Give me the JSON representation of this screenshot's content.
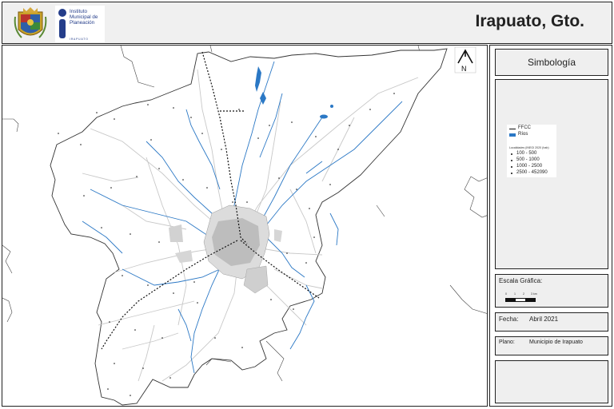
{
  "header": {
    "title": "Irapuato, Gto.",
    "institute_lines": [
      "Instituto",
      "Municipal de",
      "Planeación"
    ],
    "institute_sub": "IRAPUATO"
  },
  "map": {
    "north_label": "N",
    "colors": {
      "rivers": "#2b78c5",
      "railway": "#111111",
      "roads": "#c8c8c8",
      "municipality_fill": "#ffffff",
      "surroundings": "#ffffff"
    }
  },
  "legend": {
    "title": "Simbología",
    "railway_label": "FFCC",
    "rivers_label": "Ríos",
    "localities_title": "Localidades (INEGI 2020 (hab)",
    "population_ranges": [
      "100 - 500",
      "500 - 1000",
      "1000 - 2500",
      "2500 - 452090"
    ]
  },
  "scale": {
    "label": "Escala Gráfica:",
    "ticks": [
      "0",
      "1",
      "2",
      "3 km"
    ]
  },
  "date": {
    "label": "Fecha:",
    "value": "Abril 2021"
  },
  "plan": {
    "label": "Plano:",
    "value": "Municipio de Irapuato"
  }
}
